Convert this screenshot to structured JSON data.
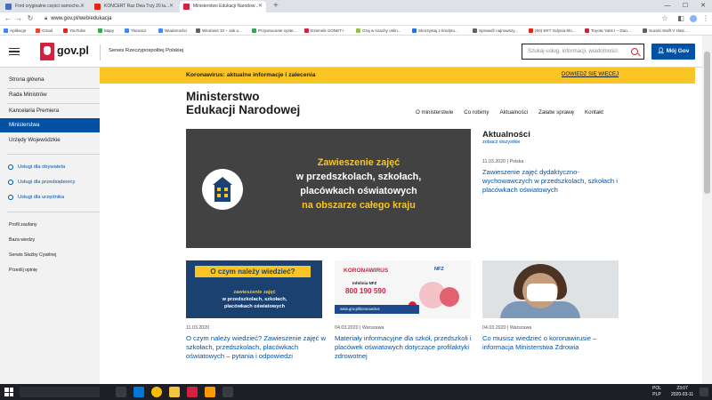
{
  "browser": {
    "tabs": [
      {
        "label": "Ford oryginalne części samocho...",
        "active": false,
        "color": "#4b6cb7"
      },
      {
        "label": "KONCERT Raz Dwa Trzy 20 la...",
        "active": false,
        "color": "#e62117"
      },
      {
        "label": "Ministerstwo Edukacji Narodow...",
        "active": true,
        "color": "#d4213d"
      }
    ],
    "url": "www.gov.pl/web/edukacja",
    "bookmarks": [
      {
        "label": "Aplikacje",
        "color": "#4285f4"
      },
      {
        "label": "Gmail",
        "color": "#ea4335"
      },
      {
        "label": "YouTube",
        "color": "#e62117"
      },
      {
        "label": "Mapy",
        "color": "#34a853"
      },
      {
        "label": "Tłumacz",
        "color": "#4285f4"
      },
      {
        "label": "Wiadomości",
        "color": "#4285f4"
      },
      {
        "label": "Windows 10 – Jak u...",
        "color": "#5f6368"
      },
      {
        "label": "Przywracanie syste...",
        "color": "#34a853"
      },
      {
        "label": "Dziennik UONET+",
        "color": "#d4213d"
      },
      {
        "label": "Graj w szachy onlin...",
        "color": "#8bc34a"
      },
      {
        "label": "Skorzystaj z kredytu...",
        "color": "#1a73e8"
      },
      {
        "label": "Sprawdź najnowszy...",
        "color": "#5f6368"
      },
      {
        "label": "(60) EKT Gdynia Mo...",
        "color": "#e62117"
      },
      {
        "label": "Toyota Yaris I – Dan...",
        "color": "#d4213d"
      },
      {
        "label": "Suzuki Swift V Hatc...",
        "color": "#5f6368"
      }
    ]
  },
  "header": {
    "logo": "gov.pl",
    "service": "Serwis Rzeczypospolitej Polskiej",
    "search_placeholder": "Szukaj usług, informacji, wiadomości",
    "login_label": "Mój Gov"
  },
  "banner": {
    "text": "Koronawirus: aktualne informacje i zalecenia",
    "link": "DOWIEDZ SIĘ WIĘCEJ"
  },
  "sidebar": {
    "items": [
      {
        "label": "Strona główna",
        "active": false
      },
      {
        "label": "Rada Ministrów",
        "active": false
      },
      {
        "label": "Kancelaria Premiera",
        "active": false
      },
      {
        "label": "Ministerstwa",
        "active": true
      },
      {
        "label": "Urzędy Wojewódzkie",
        "active": false
      }
    ],
    "services": [
      "Usługi dla obywatela",
      "Usługi dla przedsiębiorcy",
      "Usługi dla urzędnika"
    ],
    "links": [
      "Profil zaufany",
      "Baza wiedzy",
      "Serwis Służby Cywilnej",
      "Prześlij opinię"
    ]
  },
  "main": {
    "title_line1": "Ministerstwo",
    "title_line2": "Edukacji Narodowej",
    "nav": [
      "O ministerstwie",
      "Co robimy",
      "Aktualności",
      "Załatw sprawę",
      "Kontakt"
    ],
    "hero": {
      "line1": "Zawieszenie zajęć",
      "line2": "w przedszkolach, szkołach,",
      "line3": "placówkach oświatowych",
      "line4": "na obszarze całego kraju"
    },
    "news": {
      "heading": "Aktualności",
      "see_all": "zobacz wszystkie",
      "date": "11.03.2020",
      "place": "Polska",
      "title": "Zawieszenie zajęć dydaktyczno-wychowawczych w przedszkolach, szkołach i placówkach oświatowych"
    },
    "cards": [
      {
        "img_title": "O czym należy wiedzieć?",
        "img_line1": "zawieszenie zajęć",
        "img_line2": "w przedszkolach, szkołach,",
        "img_line3": "placówkach oświatowych",
        "date": "11.03.2020",
        "place": "",
        "title": "O czym należy wiedzieć? Zawieszenie zajęć w szkołach, przedszkolach, placówkach oświatowych – pytania i odpowiedzi"
      },
      {
        "img_title": "KORONAWIRUS",
        "img_org": "NFZ",
        "img_info": "Infolinia NFZ",
        "img_phone": "800 190 590",
        "img_url": "www.gov.pl/koronawirus",
        "date": "04.03.2020",
        "place": "Warszawa",
        "title": "Materiały informacyjne dla szkół, przedszkoli i placówek oświatowych dotyczące profilaktyki zdrowotnej"
      },
      {
        "date": "04.03.2020",
        "place": "Warszawa",
        "title": "Co musisz wiedzieć o koronawirusie – informacja Ministerstwa Zdrowia"
      }
    ]
  },
  "taskbar": {
    "lang": "POL",
    "layout": "PLP",
    "time": "23:07",
    "date": "2020-03-11"
  }
}
